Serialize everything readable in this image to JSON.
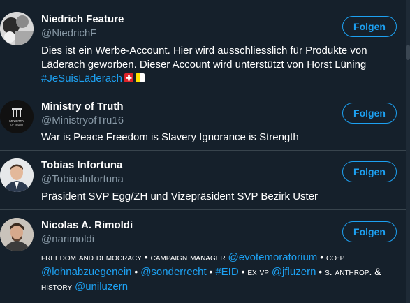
{
  "users": [
    {
      "name": "Niedrich Feature",
      "handle": "@NiedrichF",
      "follow_label": "Folgen",
      "bio_line1": "Dies ist ein Werbe-Account. Hier wird ausschliesslich für Produkte von",
      "bio_line2": "Läderach geworben. Dieser Account wird unterstützt von Horst Lüning",
      "bio_hashtag": "#JeSuisLäderach"
    },
    {
      "name": "Ministry of Truth",
      "handle": "@MinistryofTru16",
      "follow_label": "Folgen",
      "bio": "War is Peace Freedom is Slavery Ignorance is Strength",
      "avatar_text_1": "MINISTRY",
      "avatar_text_2": "OF TRUTH"
    },
    {
      "name": "Tobias Infortuna",
      "handle": "@TobiasInfortuna",
      "follow_label": "Folgen",
      "bio": "Präsident SVP Egg/ZH und Vizepräsident SVP Bezirk Uster"
    },
    {
      "name": "Nicolas A. Rimoldi",
      "handle": "@narimoldi",
      "follow_label": "Folgen",
      "bio_parts": {
        "t1": "freedom and democracy • campaign manager ",
        "l1": "@evotemoratorium",
        "t2": " • co-p",
        "l2": "@lohnabzuegenein",
        "t3": " • ",
        "l3": "@sonderrecht",
        "t4": " • ",
        "l4": "#EID",
        "t5": " • ex vp ",
        "l5": "@jfluzern",
        "t6": " • s. anthrop. &",
        "t7": "history ",
        "l7": "@uniluzern"
      }
    }
  ],
  "colors": {
    "background": "#15202b",
    "accent": "#1da1f2",
    "secondary_text": "#8899a6",
    "divider": "#38444d"
  }
}
